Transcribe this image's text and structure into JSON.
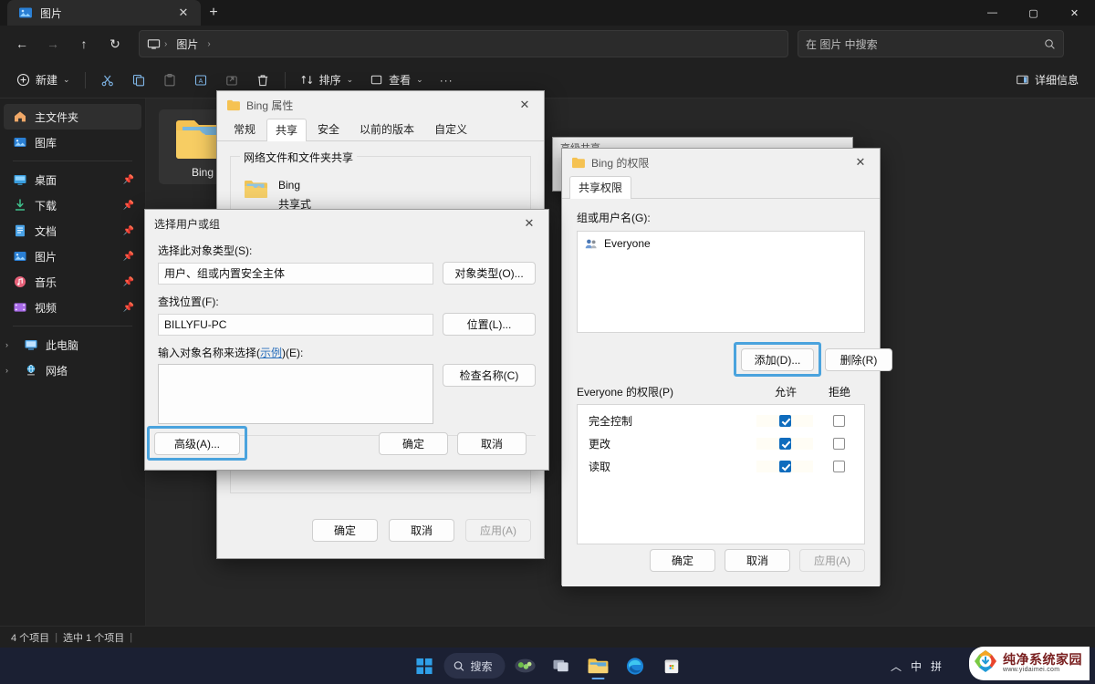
{
  "explorer": {
    "tab": {
      "title": "图片",
      "icon": "pictures-icon",
      "close": "✕",
      "new_tab": "+"
    },
    "window_controls": {
      "minimize": "—",
      "maximize": "▢",
      "close": "✕"
    },
    "nav": {
      "back": "←",
      "forward": "→",
      "up": "↑",
      "refresh": "↻",
      "breadcrumb_root_icon": "monitor-icon",
      "breadcrumb": [
        "图片"
      ],
      "sep": "›"
    },
    "search": {
      "placeholder": "在 图片 中搜索",
      "icon": "search-icon"
    },
    "commandbar": {
      "new_label": "新建",
      "new_chevron": "⌄",
      "cut": "✂",
      "copy": "⧉",
      "paste": "📋",
      "rename": "🇦",
      "share": "↗",
      "delete": "🗑",
      "sort_label": "排序",
      "sort_chevron": "⌄",
      "view_label": "查看",
      "view_chevron": "⌄",
      "more": "···",
      "details_label": "详细信息"
    },
    "sidebar": [
      {
        "label": "主文件夹",
        "icon": "home-icon",
        "selected": true,
        "pinned": false,
        "expandable": false
      },
      {
        "label": "图库",
        "icon": "gallery-icon",
        "selected": false,
        "pinned": false,
        "expandable": false
      },
      {
        "divider": true
      },
      {
        "label": "桌面",
        "icon": "desktop-icon",
        "selected": false,
        "pinned": true,
        "expandable": false
      },
      {
        "label": "下载",
        "icon": "downloads-icon",
        "selected": false,
        "pinned": true,
        "expandable": false
      },
      {
        "label": "文档",
        "icon": "documents-icon",
        "selected": false,
        "pinned": true,
        "expandable": false
      },
      {
        "label": "图片",
        "icon": "pictures-icon",
        "selected": false,
        "pinned": true,
        "expandable": false
      },
      {
        "label": "音乐",
        "icon": "music-icon",
        "selected": false,
        "pinned": true,
        "expandable": false
      },
      {
        "label": "视频",
        "icon": "videos-icon",
        "selected": false,
        "pinned": true,
        "expandable": false
      },
      {
        "divider": true
      },
      {
        "label": "此电脑",
        "icon": "this-pc-icon",
        "selected": false,
        "pinned": false,
        "expandable": true
      },
      {
        "label": "网络",
        "icon": "network-icon",
        "selected": false,
        "pinned": false,
        "expandable": true
      }
    ],
    "files": [
      {
        "name": "Bing",
        "type": "folder",
        "selected": true
      }
    ],
    "statusbar": {
      "count": "4 个项目",
      "sep": "|",
      "selection": "选中 1 个项目",
      "sep2": "|"
    }
  },
  "properties_dialog": {
    "title": "Bing 属性",
    "icon": "folder-icon",
    "close": "✕",
    "tabs": [
      {
        "label": "常规",
        "active": false
      },
      {
        "label": "共享",
        "active": true
      },
      {
        "label": "安全",
        "active": false
      },
      {
        "label": "以前的版本",
        "active": false
      },
      {
        "label": "自定义",
        "active": false
      }
    ],
    "group_label": "网络文件和文件夹共享",
    "share_name": "Bing",
    "share_state": "共享式",
    "buttons": [
      {
        "label": "确定",
        "disabled": false
      },
      {
        "label": "取消",
        "disabled": false
      },
      {
        "label": "应用(A)",
        "disabled": true
      }
    ]
  },
  "advanced_share_dialog": {
    "title": "高级共享",
    "collapse_glyph": "⌄"
  },
  "select_users_dialog": {
    "title": "选择用户或组",
    "close": "✕",
    "object_type_label": "选择此对象类型(S):",
    "object_type_value": "用户、组或内置安全主体",
    "object_type_button": "对象类型(O)...",
    "location_label": "查找位置(F):",
    "location_value": "BILLYFU-PC",
    "location_button": "位置(L)...",
    "enter_names_label_pre": "输入对象名称来选择(",
    "enter_names_link": "示例",
    "enter_names_label_post": ")(E):",
    "enter_names_value": "",
    "check_names_button": "检查名称(C)",
    "advanced_button": "高级(A)...",
    "advanced_highlighted": true,
    "ok_button": "确定",
    "cancel_button": "取消"
  },
  "permissions_dialog": {
    "title": "Bing 的权限",
    "icon": "folder-icon",
    "close": "✕",
    "tabs": [
      {
        "label": "共享权限",
        "active": true
      }
    ],
    "group_users_label": "组或用户名(G):",
    "group_users": [
      {
        "name": "Everyone",
        "icon": "users-icon",
        "selected": false
      }
    ],
    "add_button": "添加(D)...",
    "add_highlighted": true,
    "remove_button": "删除(R)",
    "permissions_label": "Everyone 的权限(P)",
    "allow_header": "允许",
    "deny_header": "拒绝",
    "permissions": [
      {
        "name": "完全控制",
        "allow": true,
        "deny": false
      },
      {
        "name": "更改",
        "allow": true,
        "deny": false
      },
      {
        "name": "读取",
        "allow": true,
        "deny": false
      }
    ],
    "buttons": [
      {
        "label": "确定",
        "disabled": false
      },
      {
        "label": "取消",
        "disabled": false
      },
      {
        "label": "应用(A)",
        "disabled": true
      }
    ]
  },
  "taskbar": {
    "start_label": "start-icon",
    "search_placeholder": "搜索",
    "search_icon": "search-icon",
    "items": [
      {
        "name": "widgets-icon"
      },
      {
        "name": "task-view-icon"
      },
      {
        "name": "file-explorer-icon",
        "active": true
      },
      {
        "name": "edge-icon"
      },
      {
        "name": "store-icon"
      }
    ],
    "tray": {
      "chevron": "︿",
      "ime": "中",
      "extra": "拼"
    },
    "watermark": {
      "cn": "纯净系统家园",
      "url": "www.yidaimei.com"
    }
  },
  "colors": {
    "accent_highlight": "#4aa3dd",
    "checkbox_checked": "#0f6cbd",
    "dialog_bg": "#f0f0f0",
    "explorer_bg": "#202020",
    "content_bg": "#272727",
    "taskbar_bg": "#1b2033"
  }
}
